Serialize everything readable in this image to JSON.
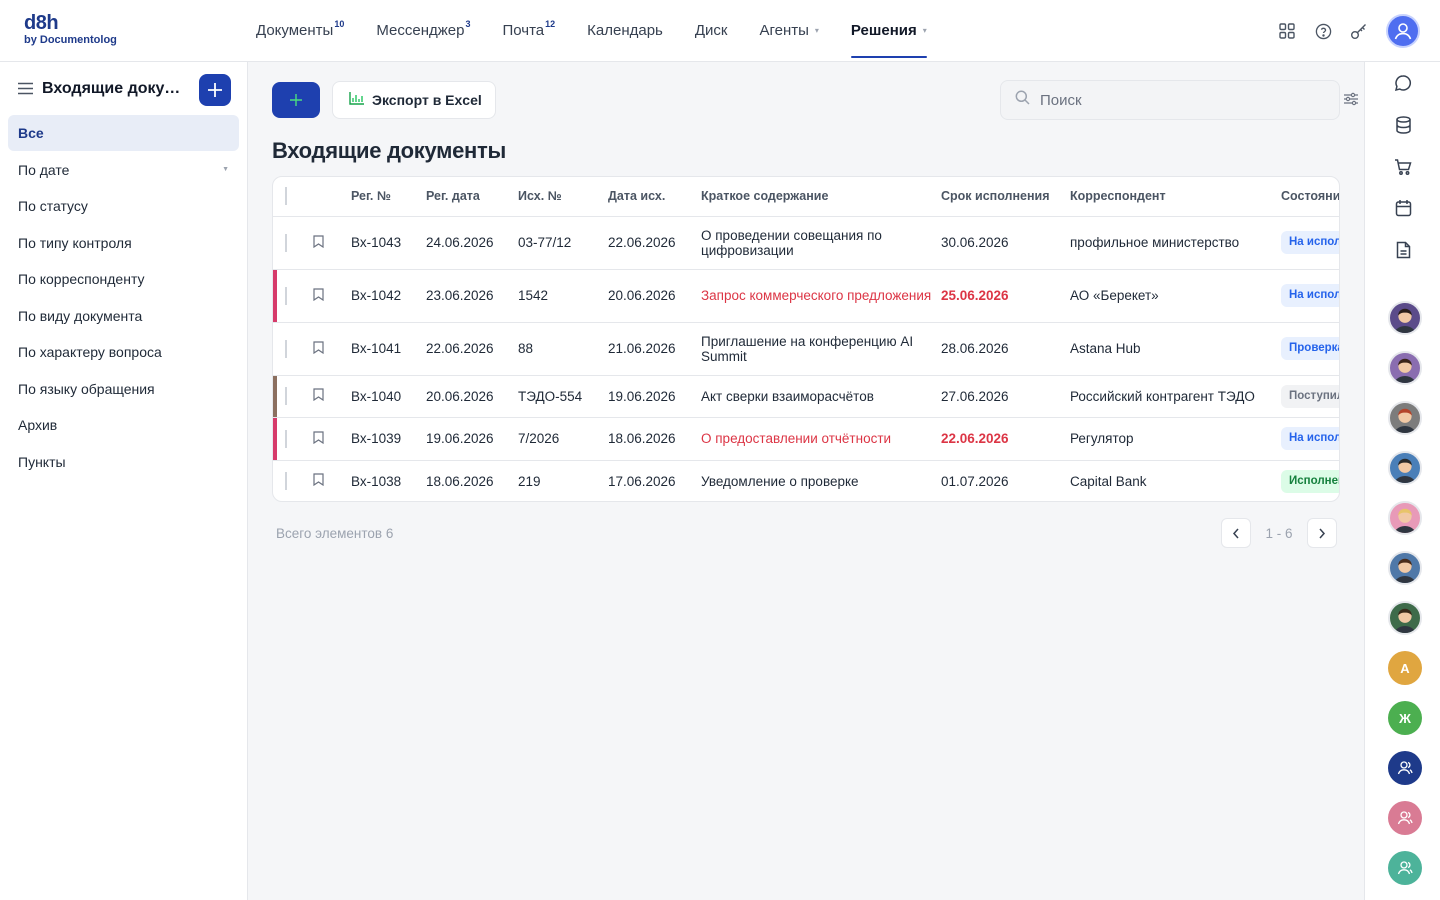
{
  "app": {
    "logo_main": "d8h",
    "logo_sub": "by Documentolog"
  },
  "nav": [
    {
      "label": "Документы",
      "badge": "10",
      "dropdown": false,
      "active": false
    },
    {
      "label": "Мессенджер",
      "badge": "3",
      "dropdown": false,
      "active": false
    },
    {
      "label": "Почта",
      "badge": "12",
      "dropdown": false,
      "active": false
    },
    {
      "label": "Календарь",
      "badge": "",
      "dropdown": false,
      "active": false
    },
    {
      "label": "Диск",
      "badge": "",
      "dropdown": false,
      "active": false
    },
    {
      "label": "Агенты",
      "badge": "",
      "dropdown": true,
      "active": false
    },
    {
      "label": "Решения",
      "badge": "",
      "dropdown": true,
      "active": true
    }
  ],
  "top_icons": [
    "apps-grid-icon",
    "help-icon",
    "key-icon"
  ],
  "sidebar": {
    "title": "Входящие документы",
    "items": [
      {
        "label": "Все",
        "active": true,
        "caret": false
      },
      {
        "label": "По дате",
        "active": false,
        "caret": true
      },
      {
        "label": "По статусу",
        "active": false,
        "caret": false
      },
      {
        "label": "По типу контроля",
        "active": false,
        "caret": false
      },
      {
        "label": "По корреспонденту",
        "active": false,
        "caret": false
      },
      {
        "label": "По виду документа",
        "active": false,
        "caret": false
      },
      {
        "label": "По характеру вопроса",
        "active": false,
        "caret": false
      },
      {
        "label": "По языку обращения",
        "active": false,
        "caret": false
      },
      {
        "label": "Архив",
        "active": false,
        "caret": false
      },
      {
        "label": "Пункты",
        "active": false,
        "caret": false
      }
    ]
  },
  "toolbar": {
    "add_icon": "plus-icon",
    "export_label": "Экспорт в Excel",
    "search_placeholder": "Поиск"
  },
  "page_title": "Входящие документы",
  "table": {
    "columns": [
      "Рег. №",
      "Рег. дата",
      "Исх. №",
      "Дата исх.",
      "Краткое содержание",
      "Срок исполнения",
      "Корреспондент",
      "Состояние"
    ],
    "rows": [
      {
        "marker": "",
        "reg_no": "Вх-1043",
        "reg_date": "24.06.2026",
        "out_no": "03-77/12",
        "out_date": "22.06.2026",
        "summary": "О проведении совещания по цифровизации",
        "summary_red": false,
        "deadline": "30.06.2026",
        "deadline_red": false,
        "correspondent": "профильное министерство",
        "status": "На исполнении",
        "status_bg": "#e8f0fe",
        "status_fg": "#2563eb"
      },
      {
        "marker": "#d63a6a",
        "reg_no": "Вх-1042",
        "reg_date": "23.06.2026",
        "out_no": "1542",
        "out_date": "20.06.2026",
        "summary": "Запрос коммерческого предложения",
        "summary_red": true,
        "deadline": "25.06.2026",
        "deadline_red": true,
        "correspondent": "АО «Берекет»",
        "status": "На исполнении",
        "status_bg": "#e8f0fe",
        "status_fg": "#2563eb"
      },
      {
        "marker": "",
        "reg_no": "Вх-1041",
        "reg_date": "22.06.2026",
        "out_no": "88",
        "out_date": "21.06.2026",
        "summary": "Приглашение на конференцию AI Summit",
        "summary_red": false,
        "deadline": "28.06.2026",
        "deadline_red": false,
        "correspondent": "Astana Hub",
        "status": "Проверка",
        "status_bg": "#e8f0fe",
        "status_fg": "#2563eb"
      },
      {
        "marker": "#8b6f5f",
        "reg_no": "Вх-1040",
        "reg_date": "20.06.2026",
        "out_no": "ТЭДО-554",
        "out_date": "19.06.2026",
        "summary": "Акт сверки взаиморасчётов",
        "summary_red": false,
        "deadline": "27.06.2026",
        "deadline_red": false,
        "correspondent": "Российский контрагент ТЭДО",
        "status": "Поступил",
        "status_bg": "#f1f2f4",
        "status_fg": "#6b7280"
      },
      {
        "marker": "#d63a6a",
        "reg_no": "Вх-1039",
        "reg_date": "19.06.2026",
        "out_no": "7/2026",
        "out_date": "18.06.2026",
        "summary": "О предоставлении отчётности",
        "summary_red": true,
        "deadline": "22.06.2026",
        "deadline_red": true,
        "correspondent": "Регулятор",
        "status": "На исполнении",
        "status_bg": "#e8f0fe",
        "status_fg": "#2563eb"
      },
      {
        "marker": "",
        "reg_no": "Вх-1038",
        "reg_date": "18.06.2026",
        "out_no": "219",
        "out_date": "17.06.2026",
        "summary": "Уведомление о проверке",
        "summary_red": false,
        "deadline": "01.07.2026",
        "deadline_red": false,
        "correspondent": "Capital Bank",
        "status": "Исполнен",
        "status_bg": "#dcfce7",
        "status_fg": "#15803d"
      }
    ]
  },
  "footer": {
    "total": "Всего элементов 6",
    "range": "1 - 6"
  },
  "rail": {
    "icons": [
      "chat-icon",
      "database-icon",
      "cart-icon",
      "calendar-icon",
      "document-icon"
    ],
    "avatars": [
      {
        "type": "photo",
        "bg": "#5b4b8a",
        "hair": "#2a1f1a"
      },
      {
        "type": "photo",
        "bg": "#8a6db0",
        "hair": "#3a2418"
      },
      {
        "type": "photo",
        "bg": "#7c7c7c",
        "hair": "#b4442a"
      },
      {
        "type": "photo",
        "bg": "#4a7fb8",
        "hair": "#2a2a2a"
      },
      {
        "type": "photo",
        "bg": "#e89ab8",
        "hair": "#e8c46a"
      },
      {
        "type": "photo",
        "bg": "#4f78a8",
        "hair": "#4a2c1a"
      },
      {
        "type": "photo",
        "bg": "#3e6b4a",
        "hair": "#3a2a1a"
      },
      {
        "type": "letter",
        "letter": "А",
        "bg": "#e0a640"
      },
      {
        "type": "letter",
        "letter": "Ж",
        "bg": "#4caf50"
      },
      {
        "type": "user",
        "bg": "#1e3a8a"
      },
      {
        "type": "user",
        "bg": "#d97b94"
      },
      {
        "type": "user",
        "bg": "#4db39a"
      }
    ]
  },
  "colors": {
    "primary": "#1e40af",
    "accent_green": "#4ade80",
    "danger": "#dc3545"
  }
}
